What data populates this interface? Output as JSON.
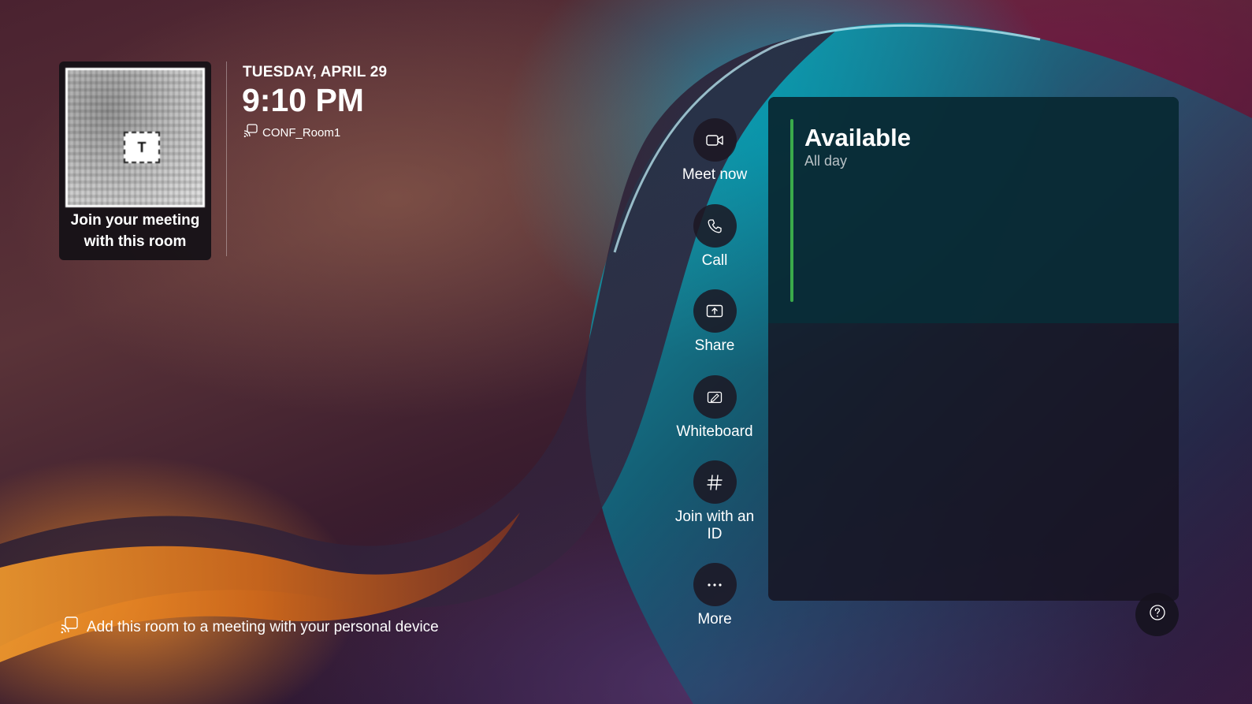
{
  "qr_card": {
    "logo_text": "T",
    "caption": "Join your meeting with this room"
  },
  "header": {
    "date": "TUESDAY, APRIL 29",
    "time": "9:10 PM",
    "room_name": "CONF_Room1"
  },
  "actions": [
    {
      "label": "Meet now",
      "icon": "video-camera-icon"
    },
    {
      "label": "Call",
      "icon": "phone-icon"
    },
    {
      "label": "Share",
      "icon": "share-screen-icon"
    },
    {
      "label": "Whiteboard",
      "icon": "whiteboard-icon"
    },
    {
      "label": "Join with an ID",
      "icon": "hash-icon"
    },
    {
      "label": "More",
      "icon": "more-icon"
    }
  ],
  "calendar_panel": {
    "status": "Available",
    "status_detail": "All day",
    "status_color": "#3aaa4a"
  },
  "footer": {
    "hint": "Add this room to a meeting with your personal device"
  },
  "help": {
    "icon": "help-icon"
  }
}
